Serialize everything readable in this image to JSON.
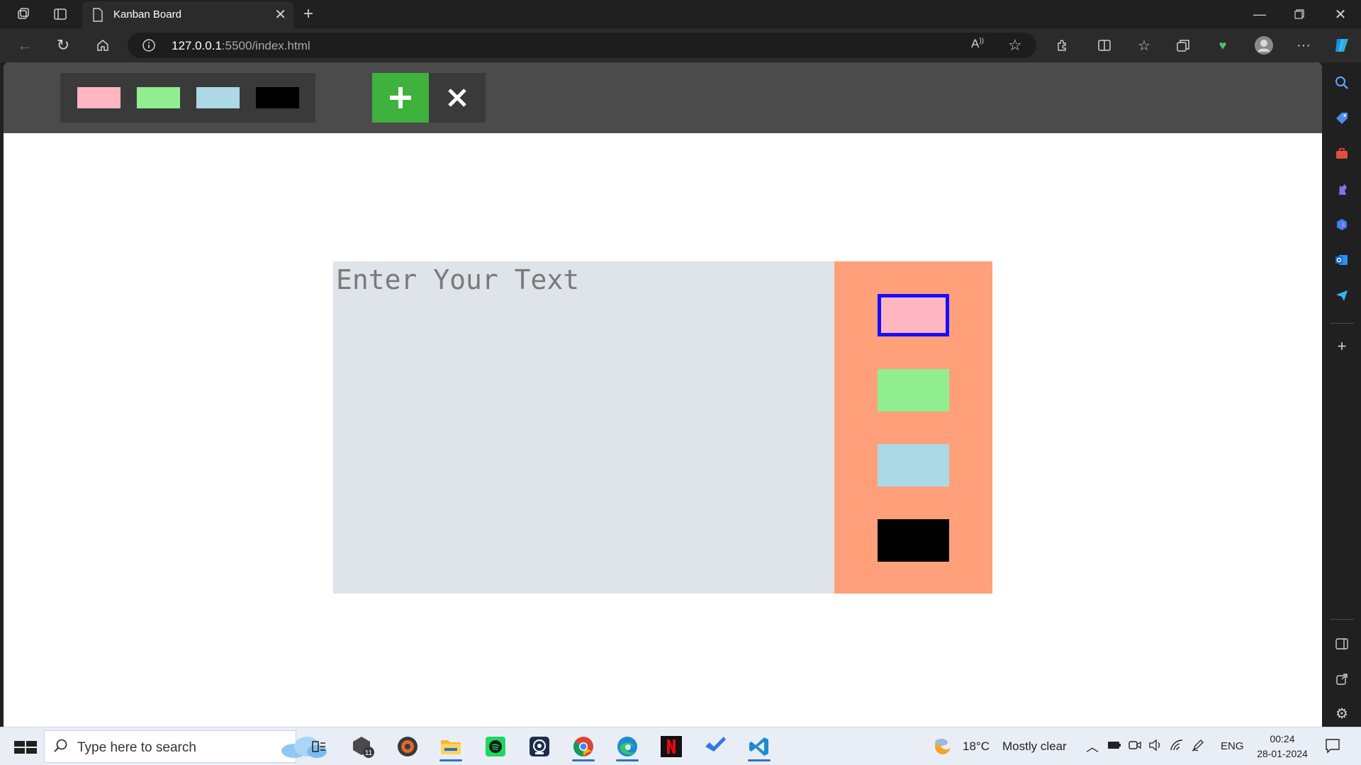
{
  "browser": {
    "tab_title": "Kanban Board",
    "url_host": "127.0.0.1",
    "url_path": ":5500/index.html"
  },
  "toolbar": {
    "colors": [
      "#ffb6c1",
      "#90ee90",
      "#add8e6",
      "#000000"
    ],
    "add_icon": "plus-icon",
    "remove_icon": "close-icon"
  },
  "modal": {
    "placeholder": "Enter Your Text",
    "priority_colors": [
      "#ffb6c1",
      "#90ee90",
      "#add8e6",
      "#000000"
    ],
    "active_priority": 0,
    "panel_color": "#ffa07a"
  },
  "taskbar": {
    "search_placeholder": "Type here to search",
    "weather_temp": "18°C",
    "weather_desc": "Mostly clear",
    "language": "ENG",
    "time": "00:24",
    "date": "28-01-2024"
  }
}
